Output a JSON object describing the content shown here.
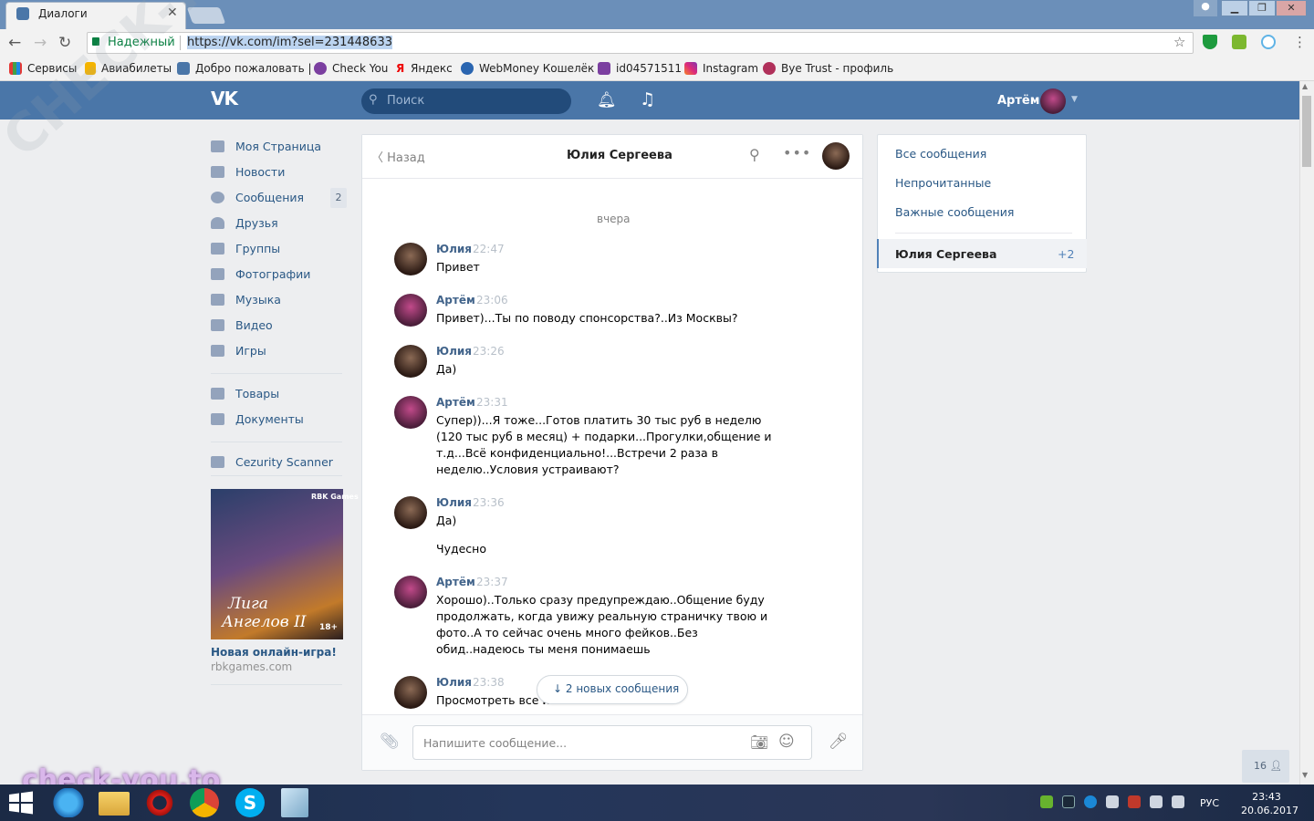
{
  "browser": {
    "tab_title": "Диалоги",
    "secure_label": "Надежный",
    "url": "https://vk.com/im?sel=231448633",
    "bookmarks": [
      "Сервисы",
      "Авиабилеты",
      "Добро пожаловать |",
      "Check You",
      "Яндекс",
      "WebMoney Кошелёк",
      "id04571511",
      "Instagram",
      "Bye Trust - профиль"
    ]
  },
  "header": {
    "search_placeholder": "Поиск",
    "user_name": "Артём"
  },
  "left_menu": {
    "items": [
      "Моя Страница",
      "Новости",
      "Сообщения",
      "Друзья",
      "Группы",
      "Фотографии",
      "Музыка",
      "Видео",
      "Игры"
    ],
    "messages_badge": "2",
    "items2": [
      "Товары",
      "Документы"
    ],
    "app": "Cezurity Scanner",
    "ad": {
      "brand": "RBK Games",
      "title_line1": "Лига",
      "title_line2": "Ангелов II",
      "age": "18+",
      "name": "Новая онлайн-игра!",
      "domain": "rbkgames.com"
    }
  },
  "chat": {
    "back": "Назад",
    "title": "Юлия Сергеева",
    "day_label": "вчера",
    "messages": [
      {
        "author": "Юлия",
        "time": "22:47",
        "text": "Привет"
      },
      {
        "author": "Артём",
        "time": "23:06",
        "text": "Привет)...Ты по поводу спонсорства?..Из Москвы?"
      },
      {
        "author": "Юлия",
        "time": "23:26",
        "text": "Да)"
      },
      {
        "author": "Артём",
        "time": "23:31",
        "text": "Супер))...Я тоже...Готов платить 30 тыс руб в неделю (120 тыс руб в месяц) + подарки...Прогулки,общение и т.д...Всё конфиденциально!...Встречи 2 раза в неделю..Условия устраивают?"
      },
      {
        "author": "Юлия",
        "time": "23:36",
        "text": "Да)"
      },
      {
        "author": "",
        "time": "",
        "text": "Чудесно"
      },
      {
        "author": "Артём",
        "time": "23:37",
        "text": "Хорошо)..Только сразу предупреждаю..Общение буду продолжать, когда увижу реальную страничку твою и фото..А то сейчас очень много фейков..Без обид..надеюсь ты меня понимаешь"
      },
      {
        "author": "Юлия",
        "time": "23:38",
        "text": "Просмотреть все и"
      }
    ],
    "new_messages": "2 новых сообщения",
    "input_placeholder": "Напишите сообщение..."
  },
  "right_panel": {
    "links": [
      "Все сообщения",
      "Непрочитанные",
      "Важные сообщения"
    ],
    "active_dialog": "Юлия Сергеева",
    "active_count": "+2",
    "online_count": "16"
  },
  "watermark": {
    "diagonal": "CHECK-YOU.ME",
    "bottom": "check-you.to"
  },
  "taskbar": {
    "lang": "РУС",
    "time": "23:43",
    "date": "20.06.2017"
  },
  "colors": {
    "vk_blue": "#4a76a8",
    "link": "#2a5885",
    "secure_green": "#0b8043"
  }
}
